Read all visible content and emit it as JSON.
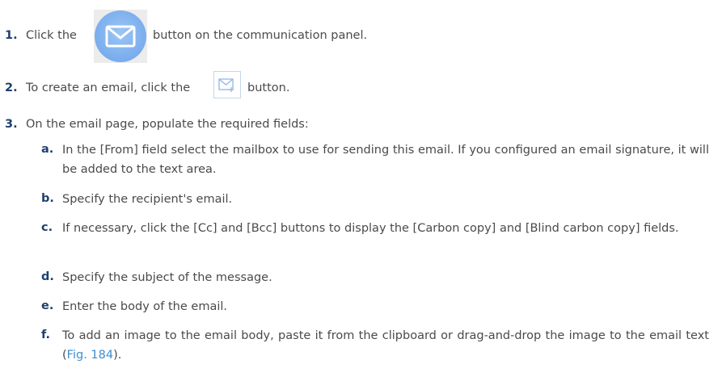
{
  "steps": [
    {
      "num": "1.",
      "before": "Click the",
      "after": "button on the communication panel."
    },
    {
      "num": "2.",
      "before": "To create an email, click the",
      "after": "button."
    },
    {
      "num": "3.",
      "text": "On the email page, populate the required fields:"
    }
  ],
  "substeps": [
    {
      "num": "a.",
      "text": "In the [From] field select the mailbox to use for sending this email. If you configured an email signature, it will be added to the text area."
    },
    {
      "num": "b.",
      "text": "Specify the recipient's email."
    },
    {
      "num": "c.",
      "text": "If necessary, click the [Cc] and [Bcc] buttons to display the [Carbon copy] and [Blind carbon copy] fields."
    },
    {
      "num": "d.",
      "text": "Specify the subject of the message."
    },
    {
      "num": "e.",
      "text": "Enter the body of the email."
    },
    {
      "num": "f.",
      "text": "To add an image to the email body, paste it from the clipboard or drag-and-drop the image to the email text (",
      "link": "Fig. 184",
      "end": ")."
    }
  ],
  "colors": {
    "number": "#1f3f6e",
    "text": "#4a4a4a",
    "link": "#3d8fd1",
    "icon_blue": "#7eb0ee"
  },
  "icons": {
    "communication_email": "envelope-icon",
    "new_email": "envelope-plus-icon"
  }
}
